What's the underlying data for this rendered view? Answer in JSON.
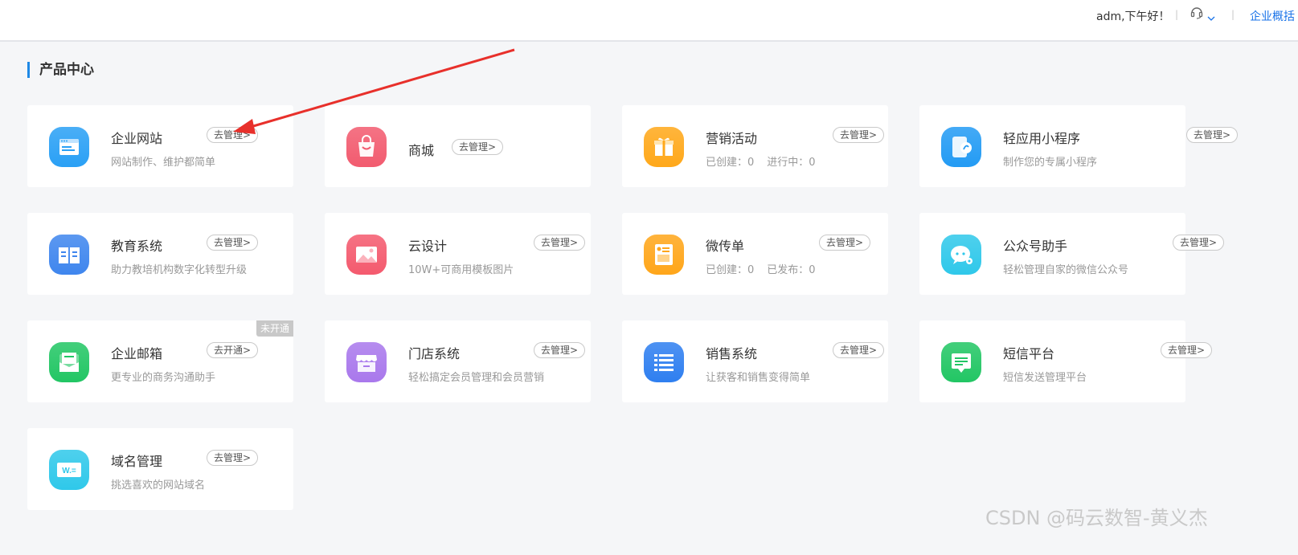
{
  "header": {
    "greeting": "adm,下午好！",
    "separator": "|",
    "overview_link": "企业概括"
  },
  "section": {
    "title": "产品中心"
  },
  "products": [
    {
      "name": "企业网站",
      "action": "去管理>",
      "desc": "网站制作、维护都简单",
      "icon": "website-icon",
      "color": "#2aa0f5"
    },
    {
      "name": "商城",
      "action": "去管理>",
      "desc": "",
      "icon": "shopping-bag-icon",
      "color": "#f25b6f"
    },
    {
      "name": "营销活动",
      "action": "去管理>",
      "stats": [
        "已创建：0",
        "进行中：0"
      ],
      "icon": "gift-icon",
      "color": "#ffa81a"
    },
    {
      "name": "轻应用小程序",
      "action": "去管理>",
      "desc": "制作您的专属小程序",
      "icon": "mini-program-icon",
      "color": "#239bf4"
    },
    {
      "name": "教育系统",
      "action": "去管理>",
      "desc": "助力教培机构数字化转型升级",
      "icon": "open-book-icon",
      "color": "#3f86ee"
    },
    {
      "name": "云设计",
      "action": "去管理>",
      "desc": "10W+可商用模板图片",
      "icon": "image-icon",
      "color": "#f45a6e"
    },
    {
      "name": "微传单",
      "action": "去管理>",
      "stats": [
        "已创建：0",
        "已发布：0"
      ],
      "icon": "flyer-icon",
      "color": "#ffa61a"
    },
    {
      "name": "公众号助手",
      "action": "去管理>",
      "desc": "轻松管理自家的微信公众号",
      "icon": "wechat-icon",
      "color": "#2fc8ea"
    },
    {
      "name": "企业邮箱",
      "action": "去开通>",
      "desc": "更专业的商务沟通助手",
      "icon": "mail-icon",
      "color": "#22c664",
      "badge": "未开通"
    },
    {
      "name": "门店系统",
      "action": "去管理>",
      "desc": "轻松搞定会员管理和会员营销",
      "icon": "store-icon",
      "color": "#a978ec"
    },
    {
      "name": "销售系统",
      "action": "去管理>",
      "desc": "让获客和销售变得简单",
      "icon": "list-icon",
      "color": "#2f7ff0"
    },
    {
      "name": "短信平台",
      "action": "去管理>",
      "desc": "短信发送管理平台",
      "icon": "sms-icon",
      "color": "#22c664"
    },
    {
      "name": "域名管理",
      "action": "去管理>",
      "desc": "挑选喜欢的网站域名",
      "icon": "domain-icon",
      "color": "#2fc8ea",
      "icon_text": "W.="
    }
  ],
  "watermark": "CSDN @码云数智-黄义杰"
}
